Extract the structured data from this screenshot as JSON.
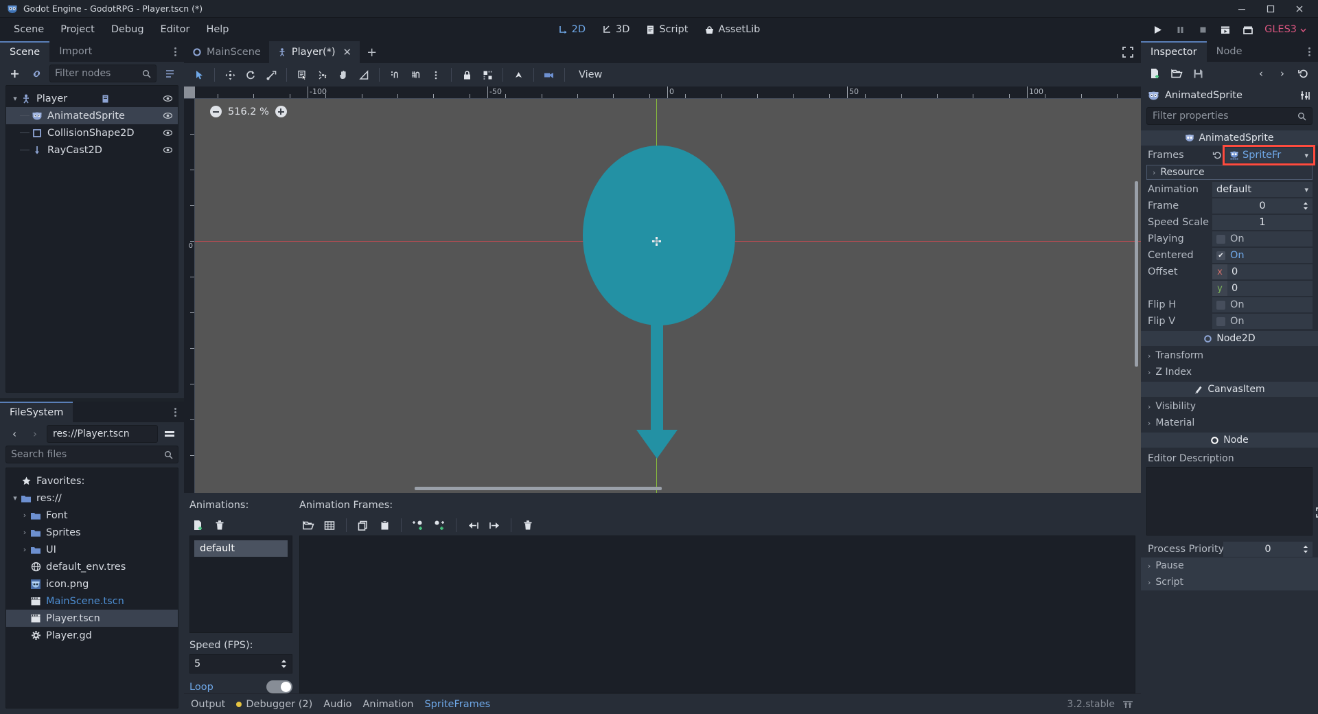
{
  "window": {
    "title": "Godot Engine - GodotRPG - Player.tscn (*)",
    "minimize": "–",
    "maximize": "❐",
    "close": "✕"
  },
  "menubar": {
    "items": [
      "Scene",
      "Project",
      "Debug",
      "Editor",
      "Help"
    ],
    "modes": [
      {
        "label": "2D",
        "icon": "2d-icon",
        "active": true
      },
      {
        "label": "3D",
        "icon": "3d-icon",
        "active": false
      },
      {
        "label": "Script",
        "icon": "script-icon",
        "active": false
      },
      {
        "label": "AssetLib",
        "icon": "assetlib-icon",
        "active": false
      }
    ],
    "run": {
      "play": "play-icon",
      "pause": "pause-icon",
      "stop": "stop-icon",
      "play_scene": "play-scene-icon",
      "play_custom": "play-custom-scene-icon",
      "renderer": "GLES3"
    }
  },
  "scene_dock": {
    "tabs": [
      {
        "label": "Scene",
        "active": true
      },
      {
        "label": "Import",
        "active": false
      }
    ],
    "toolbar": {
      "add": "add-node-icon",
      "link": "instance-scene-icon",
      "filter_placeholder": "Filter nodes",
      "search": "search-icon",
      "extra": "node-tree-options-icon"
    },
    "nodes": [
      {
        "label": "Player",
        "icon": "kinematicbody2d-icon",
        "depth": 0,
        "expanded": true,
        "selected": false,
        "script": true,
        "visible_toggle": true
      },
      {
        "label": "AnimatedSprite",
        "icon": "animatedsprite-icon",
        "depth": 1,
        "selected": true,
        "visible_toggle": true
      },
      {
        "label": "CollisionShape2D",
        "icon": "collisionshape2d-icon",
        "depth": 1,
        "selected": false,
        "visible_toggle": true
      },
      {
        "label": "RayCast2D",
        "icon": "raycast2d-icon",
        "depth": 1,
        "selected": false,
        "visible_toggle": true
      }
    ]
  },
  "filesystem_dock": {
    "tab": "FileSystem",
    "path": "res://Player.tscn",
    "back": "‹",
    "forward": "›",
    "toggle_split": "toggle-split-mode-icon",
    "search_placeholder": "Search files",
    "entries": [
      {
        "label": "Favorites:",
        "icon": "star-icon",
        "depth": 0,
        "kind": "favorites"
      },
      {
        "label": "res://",
        "icon": "folder-icon",
        "depth": 0,
        "kind": "folder",
        "expanded": true
      },
      {
        "label": "Font",
        "icon": "folder-icon",
        "depth": 1,
        "kind": "folder",
        "expanded": false
      },
      {
        "label": "Sprites",
        "icon": "folder-icon",
        "depth": 1,
        "kind": "folder",
        "expanded": false
      },
      {
        "label": "UI",
        "icon": "folder-icon",
        "depth": 1,
        "kind": "folder",
        "expanded": false
      },
      {
        "label": "default_env.tres",
        "icon": "environment-icon",
        "depth": 1,
        "kind": "file"
      },
      {
        "label": "icon.png",
        "icon": "image-icon",
        "depth": 1,
        "kind": "file"
      },
      {
        "label": "MainScene.tscn",
        "icon": "scene-icon",
        "depth": 1,
        "kind": "scene",
        "highlight": true
      },
      {
        "label": "Player.tscn",
        "icon": "scene-icon",
        "depth": 1,
        "kind": "scene",
        "selected": true
      },
      {
        "label": "Player.gd",
        "icon": "gdscript-icon",
        "depth": 1,
        "kind": "script"
      }
    ]
  },
  "scene_tabs": {
    "tabs": [
      {
        "label": "MainScene",
        "icon": "node2d-icon",
        "active": false,
        "closable": false
      },
      {
        "label": "Player(*)",
        "icon": "kinematicbody2d-icon",
        "active": true,
        "closable": true
      }
    ],
    "add": "+",
    "close": "✕",
    "distraction_free": "distraction-free-mode-icon"
  },
  "viewport": {
    "tools": [
      {
        "name": "select-mode-icon",
        "active": true
      },
      {
        "name": "move-mode-icon"
      },
      {
        "name": "rotate-mode-icon"
      },
      {
        "name": "scale-mode-icon"
      },
      {
        "name": "list-select-icon"
      },
      {
        "name": "pivot-mode-icon"
      },
      {
        "name": "pan-mode-icon"
      },
      {
        "name": "ruler-mode-icon"
      },
      {
        "name": "snap-mode-icon"
      },
      {
        "name": "smart-snap-icon"
      },
      {
        "name": "snap-options-icon"
      },
      {
        "name": "lock-icon"
      },
      {
        "name": "group-icon"
      },
      {
        "name": "skeleton-icon"
      },
      {
        "name": "camera-override-icon"
      }
    ],
    "view_menu": "View",
    "zoom": {
      "minus": "zoom-out-icon",
      "value": "516.2 %",
      "plus": "zoom-in-icon"
    },
    "ruler": {
      "h_labels": [
        "-100",
        "-50",
        "0",
        "50",
        "100"
      ],
      "v_labels": [
        "0"
      ]
    }
  },
  "bottom_panel": {
    "animations_label": "Animations:",
    "animation_frames_label": "Animation Frames:",
    "anim_tools": [
      {
        "name": "new-animation-icon"
      },
      {
        "name": "delete-animation-icon"
      }
    ],
    "frame_tools": [
      {
        "name": "add-frame-from-file-icon"
      },
      {
        "name": "add-frames-from-sheet-icon"
      },
      {
        "name": "copy-frame-icon"
      },
      {
        "name": "paste-frame-icon"
      },
      {
        "name": "insert-empty-before-icon"
      },
      {
        "name": "insert-empty-after-icon"
      },
      {
        "name": "move-frame-left-icon"
      },
      {
        "name": "move-frame-right-icon"
      },
      {
        "name": "delete-frame-icon"
      }
    ],
    "animations": [
      {
        "label": "default",
        "selected": true
      }
    ],
    "speed_label": "Speed (FPS):",
    "speed_value": "5",
    "loop_label": "Loop",
    "loop_on": true
  },
  "statusbar": {
    "tabs": [
      {
        "label": "Output",
        "active": false
      },
      {
        "label": "Debugger (2)",
        "active": false,
        "dot": true
      },
      {
        "label": "Audio",
        "active": false
      },
      {
        "label": "Animation",
        "active": false
      },
      {
        "label": "SpriteFrames",
        "active": true
      }
    ],
    "version": "3.2.stable",
    "layout_icon": "editor-layout-icon"
  },
  "inspector": {
    "tabs": [
      {
        "label": "Inspector",
        "active": true
      },
      {
        "label": "Node",
        "active": false
      }
    ],
    "toolbar": {
      "new_resource": "new-resource-icon",
      "load": "load-resource-icon",
      "save": "save-resource-icon",
      "back": "‹",
      "forward": "›",
      "history": "history-icon"
    },
    "node_name": "AnimatedSprite",
    "node_icon": "animatedsprite-icon",
    "object_menu": "object-tools-icon",
    "filter_placeholder": "Filter properties",
    "search_icon": "search-icon",
    "sections": [
      {
        "type": "category",
        "label": "AnimatedSprite",
        "icon": "animatedsprite-icon"
      },
      {
        "type": "resource",
        "label": "Frames",
        "value": "SpriteFr",
        "icon": "spriteframes-icon",
        "revert": "revert-icon",
        "chevron": "chevron-down-icon",
        "highlighted": true
      },
      {
        "type": "subsection",
        "label": "Resource"
      },
      {
        "type": "enum",
        "label": "Animation",
        "value": "default",
        "chevron": "chevron-down-icon"
      },
      {
        "type": "spin",
        "label": "Frame",
        "value": "0"
      },
      {
        "type": "number",
        "label": "Speed Scale",
        "value": "1"
      },
      {
        "type": "check",
        "label": "Playing",
        "value": "On",
        "checked": false
      },
      {
        "type": "check",
        "label": "Centered",
        "value": "On",
        "checked": true
      },
      {
        "type": "vector2",
        "label": "Offset",
        "x": "0",
        "y": "0",
        "x_label": "x",
        "y_label": "y"
      },
      {
        "type": "check",
        "label": "Flip H",
        "value": "On",
        "checked": false
      },
      {
        "type": "check",
        "label": "Flip V",
        "value": "On",
        "checked": false
      },
      {
        "type": "category",
        "label": "Node2D",
        "icon": "node2d-icon"
      },
      {
        "type": "subsection",
        "label": "Transform"
      },
      {
        "type": "subsection",
        "label": "Z Index"
      },
      {
        "type": "category",
        "label": "CanvasItem",
        "icon": "canvasitem-icon"
      },
      {
        "type": "subsection",
        "label": "Visibility"
      },
      {
        "type": "subsection",
        "label": "Material"
      },
      {
        "type": "category",
        "label": "Node",
        "icon": "node-icon"
      },
      {
        "type": "textarea",
        "label": "Editor Description",
        "expand": "expand-icon"
      },
      {
        "type": "spin",
        "label": "Process Priority",
        "value": "0"
      },
      {
        "type": "subsection",
        "label": "Pause"
      },
      {
        "type": "subsection",
        "label": "Script"
      }
    ]
  },
  "colors": {
    "accent": "#6fa8e8",
    "highlight_red": "#ff4b3e",
    "sprite": "#2391a4",
    "axis_x": "#cf4a52",
    "axis_y": "#8ec93a",
    "gles": "#d9557f",
    "debug_dot": "#e5c341"
  }
}
